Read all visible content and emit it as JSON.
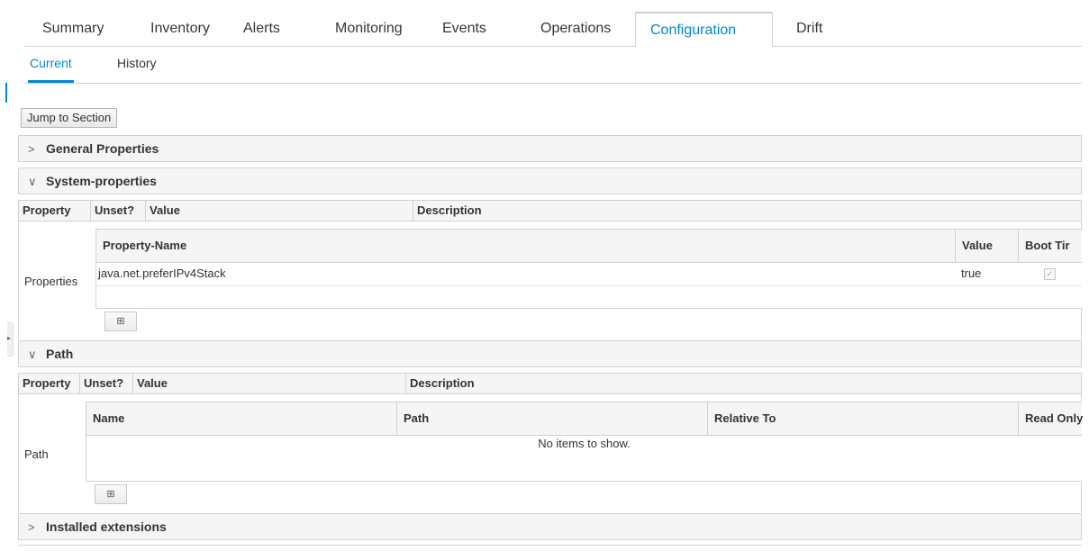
{
  "tabs": [
    "Summary",
    "Inventory",
    "Alerts",
    "Monitoring",
    "Events",
    "Operations",
    "Configuration",
    "Drift"
  ],
  "active_tab": "Configuration",
  "subtabs": [
    "Current",
    "History"
  ],
  "active_subtab": "Current",
  "jump_button": "Jump to Section",
  "sections": {
    "general": {
      "label": "General Properties",
      "chevron": ">"
    },
    "system": {
      "label": "System-properties",
      "chevron": "∨",
      "columns": {
        "property": "Property",
        "unset": "Unset?",
        "value": "Value",
        "description": "Description"
      },
      "row_label": "Properties",
      "grid": {
        "columns": {
          "name": "Property-Name",
          "value": "Value",
          "boot": "Boot Tir"
        },
        "rows": [
          {
            "name": "java.net.preferIPv4Stack",
            "value": "true",
            "boot": "✓"
          }
        ]
      },
      "add_icon": "⊞"
    },
    "path": {
      "label": "Path",
      "chevron": "∨",
      "columns": {
        "property": "Property",
        "unset": "Unset?",
        "value": "Value",
        "description": "Description"
      },
      "row_label": "Path",
      "grid": {
        "columns": {
          "name": "Name",
          "path": "Path",
          "relative": "Relative To",
          "readonly": "Read Only"
        },
        "empty": "No items to show."
      },
      "add_icon": "⊞"
    },
    "extensions": {
      "label": "Installed extensions",
      "chevron": ">"
    }
  },
  "colors": {
    "accent": "#0088ce",
    "border": "#d1d1d1",
    "header_bg": "#f5f5f5"
  }
}
